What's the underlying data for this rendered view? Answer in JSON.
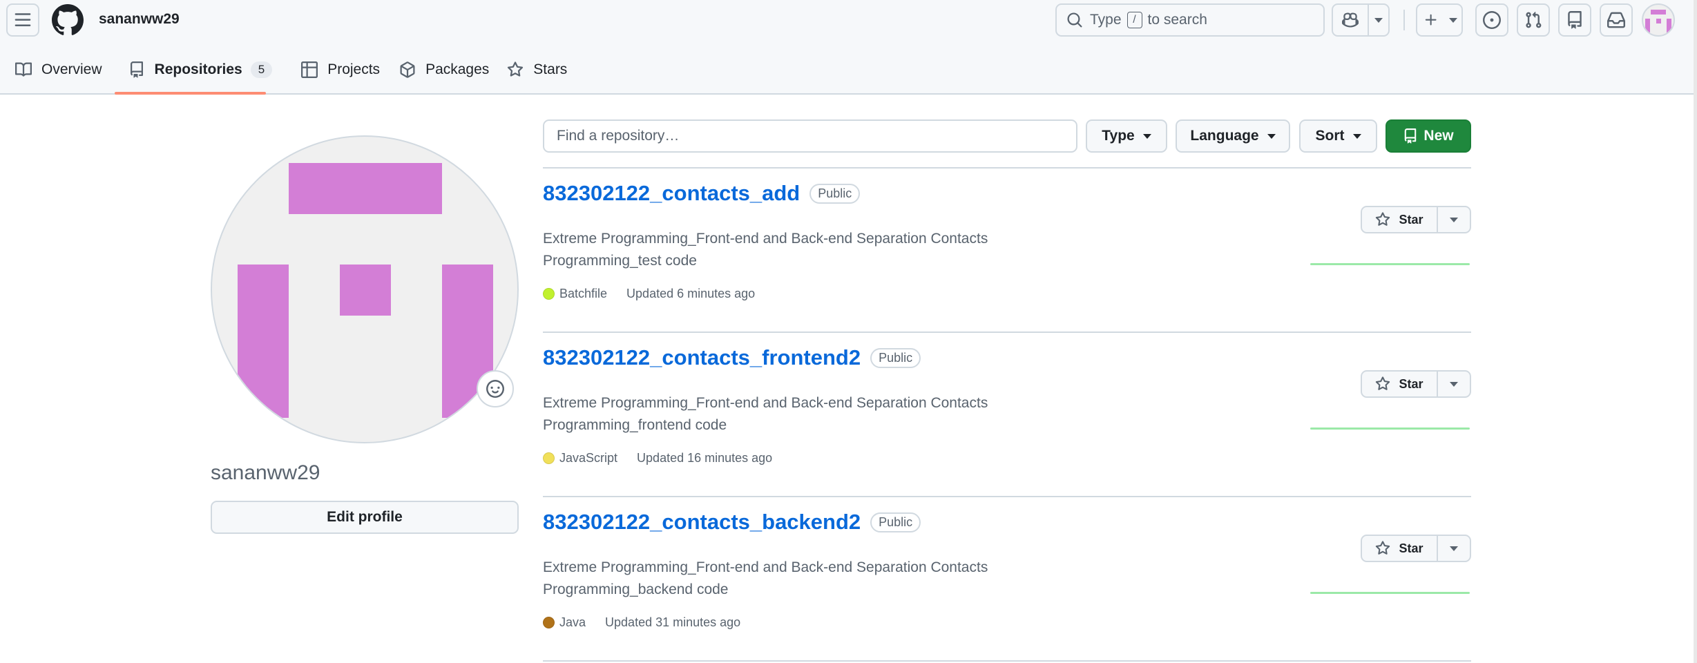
{
  "header": {
    "username": "sananww29",
    "search": {
      "prefix": "Type",
      "key": "/",
      "suffix": "to search"
    }
  },
  "tabs": [
    {
      "label": "Overview"
    },
    {
      "label": "Repositories",
      "count": "5",
      "active": true
    },
    {
      "label": "Projects"
    },
    {
      "label": "Packages"
    },
    {
      "label": "Stars"
    }
  ],
  "profile": {
    "name": "sananww29",
    "edit_label": "Edit profile"
  },
  "filters": {
    "search_placeholder": "Find a repository…",
    "type_label": "Type",
    "language_label": "Language",
    "sort_label": "Sort",
    "new_label": "New"
  },
  "repos": [
    {
      "name": "832302122_contacts_add",
      "visibility": "Public",
      "desc_line1": "Extreme Programming_Front-end and Back-end Separation Contacts",
      "desc_line2": "Programming_test code",
      "language": "Batchfile",
      "lang_color": "#C1F12E",
      "updated": "Updated 6 minutes ago",
      "star_label": "Star"
    },
    {
      "name": "832302122_contacts_frontend2",
      "visibility": "Public",
      "desc_line1": "Extreme Programming_Front-end and Back-end Separation Contacts",
      "desc_line2": "Programming_frontend code",
      "language": "JavaScript",
      "lang_color": "#F1E05A",
      "updated": "Updated 16 minutes ago",
      "star_label": "Star"
    },
    {
      "name": "832302122_contacts_backend2",
      "visibility": "Public",
      "desc_line1": "Extreme Programming_Front-end and Back-end Separation Contacts",
      "desc_line2": "Programming_backend code",
      "language": "Java",
      "lang_color": "#B07219",
      "updated": "Updated 31 minutes ago",
      "star_label": "Star"
    }
  ],
  "colors": {
    "accent_green": "#1f883d",
    "link_blue": "#0969da",
    "tab_underline": "#fd8c73",
    "identicon": "#d37ed6"
  }
}
